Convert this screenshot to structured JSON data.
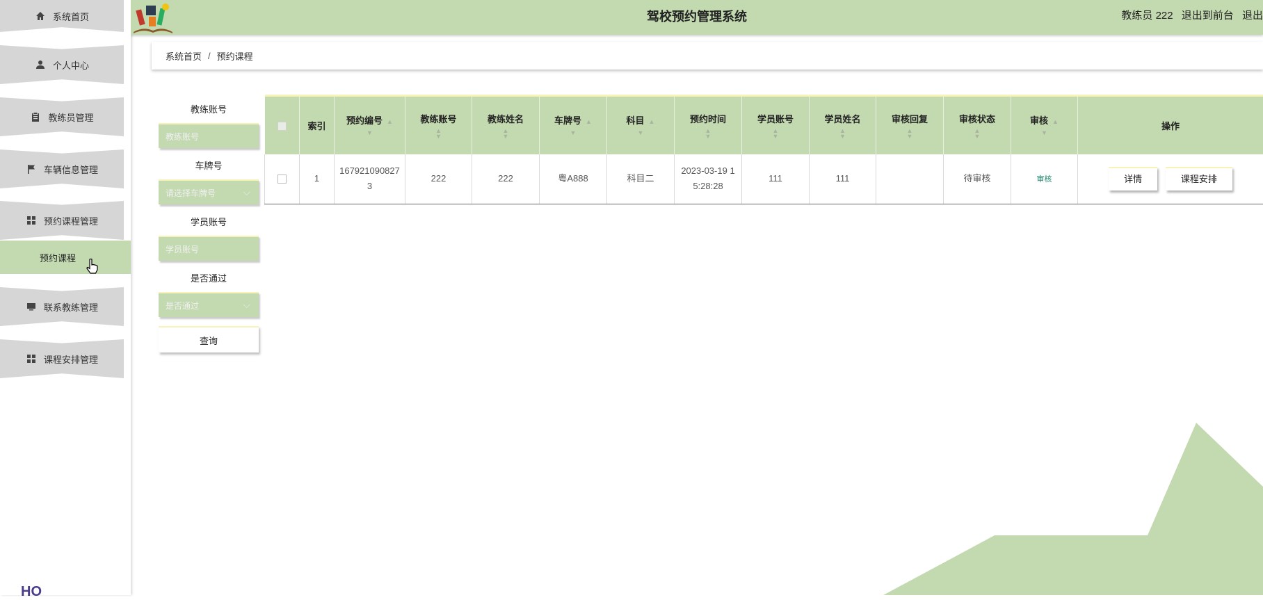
{
  "app": {
    "title": "驾校预约管理系统"
  },
  "header": {
    "user_label": "教练员 222",
    "front_link": "退出到前台",
    "logout_link": "退出"
  },
  "sidebar": {
    "items": [
      {
        "label": "系统首页",
        "icon": "home-icon"
      },
      {
        "label": "个人中心",
        "icon": "user-icon"
      },
      {
        "label": "教练员管理",
        "icon": "clipboard-icon"
      },
      {
        "label": "车辆信息管理",
        "icon": "flag-icon"
      },
      {
        "label": "预约课程管理",
        "icon": "grid-icon"
      },
      {
        "label": "联系教练管理",
        "icon": "monitor-icon"
      },
      {
        "label": "课程安排管理",
        "icon": "grid-icon"
      }
    ],
    "sub_item": "预约课程"
  },
  "breadcrumb": {
    "home": "系统首页",
    "sep": "/",
    "current": "预约课程"
  },
  "search": {
    "coach_account_label": "教练账号",
    "coach_account_placeholder": "教练账号",
    "plate_label": "车牌号",
    "plate_placeholder": "请选择车牌号",
    "student_account_label": "学员账号",
    "student_account_placeholder": "学员账号",
    "passed_label": "是否通过",
    "passed_placeholder": "是否通过",
    "query_button": "查询"
  },
  "table": {
    "headers": [
      "索引",
      "预约编号",
      "教练账号",
      "教练姓名",
      "车牌号",
      "科目",
      "预约时间",
      "学员账号",
      "学员姓名",
      "审核回复",
      "审核状态",
      "审核",
      "操作"
    ],
    "rows": [
      {
        "index": "1",
        "booking_no": "1679210908273",
        "coach_account": "222",
        "coach_name": "222",
        "plate": "粤A888",
        "subject": "科目二",
        "time": "2023-03-19 15:28:28",
        "student_account": "111",
        "student_name": "111",
        "reply": "",
        "status": "待审核",
        "review_link": "审核",
        "detail_button": "详情",
        "schedule_button": "课程安排"
      }
    ]
  },
  "colors": {
    "accent": "#c3d9b0",
    "border_highlight": "#f6f2b8",
    "link": "#1f8a6d"
  },
  "footer": {
    "logo_text": "HO"
  }
}
